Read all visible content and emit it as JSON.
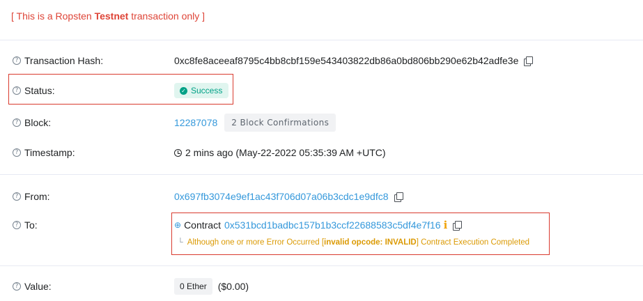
{
  "notice": {
    "prefix": "[ This is a Ropsten ",
    "bold": "Testnet",
    "suffix": " transaction only ]"
  },
  "rows": {
    "hash": {
      "label": "Transaction Hash:",
      "value": "0xc8fe8aceeaf8795c4bb8cbf159e543403822db86a0bd806bb290e62b42adfe3e"
    },
    "status": {
      "label": "Status:",
      "value": "Success"
    },
    "block": {
      "label": "Block:",
      "value": "12287078",
      "confirmations": "2 Block Confirmations"
    },
    "timestamp": {
      "label": "Timestamp:",
      "value": "2 mins ago (May-22-2022 05:35:39 AM +UTC)"
    },
    "from": {
      "label": "From:",
      "value": "0x697fb3074e9ef1ac43f706d07a06b3cdc1e9dfc8"
    },
    "to": {
      "label": "To:",
      "prefix": "Contract",
      "value": "0x531bcd1badbc157b1b3ccf22688583c5df4e7f16",
      "warning_prefix": "Although one or more Error Occurred [",
      "warning_bold": "invalid opcode: INVALID",
      "warning_suffix": "] Contract Execution Completed"
    },
    "value": {
      "label": "Value:",
      "ether": "0 Ether",
      "usd": "($0.00)"
    }
  },
  "icons": {
    "help": "question-circle-icon",
    "copy": "copy-icon",
    "check": "check-circle-icon",
    "clock": "clock-icon",
    "zoom": "zoom-in-icon",
    "info": "info-icon"
  },
  "colors": {
    "notice": "#de4437",
    "link": "#3498db",
    "success": "#00a186",
    "warning": "#db9a04",
    "highlight_box": "#d93a2e"
  }
}
